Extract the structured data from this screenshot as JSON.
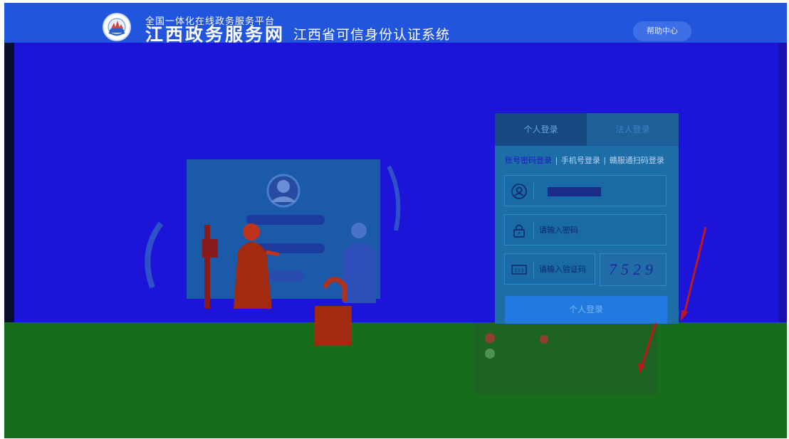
{
  "header": {
    "subtitle": "全国一体化在线政务服务平台",
    "title": "江西政务服务网",
    "system_title": "江西省可信身份认证系统",
    "help_label": "帮助中心"
  },
  "login": {
    "tabs": [
      {
        "label": "个人登录",
        "active": true
      },
      {
        "label": "法人登录",
        "active": false
      }
    ],
    "methods": [
      {
        "label": "账号密码登录",
        "active": true
      },
      {
        "label": "手机号登录",
        "active": false
      },
      {
        "label": "赣服通扫码登录",
        "active": false
      }
    ],
    "method_separator": "|",
    "password_placeholder": "请输入密码",
    "captcha_placeholder": "请输入验证码",
    "captcha_code": "7529",
    "submit_label": "个人登录"
  },
  "colors": {
    "header_bg": "#2255dd",
    "main_bg": "#1c14d8",
    "bottom_bg": "#176d1a",
    "card_bg": "#1e6fa8"
  },
  "icons": [
    "emblem-icon",
    "user-icon",
    "lock-icon",
    "captcha-icon"
  ]
}
